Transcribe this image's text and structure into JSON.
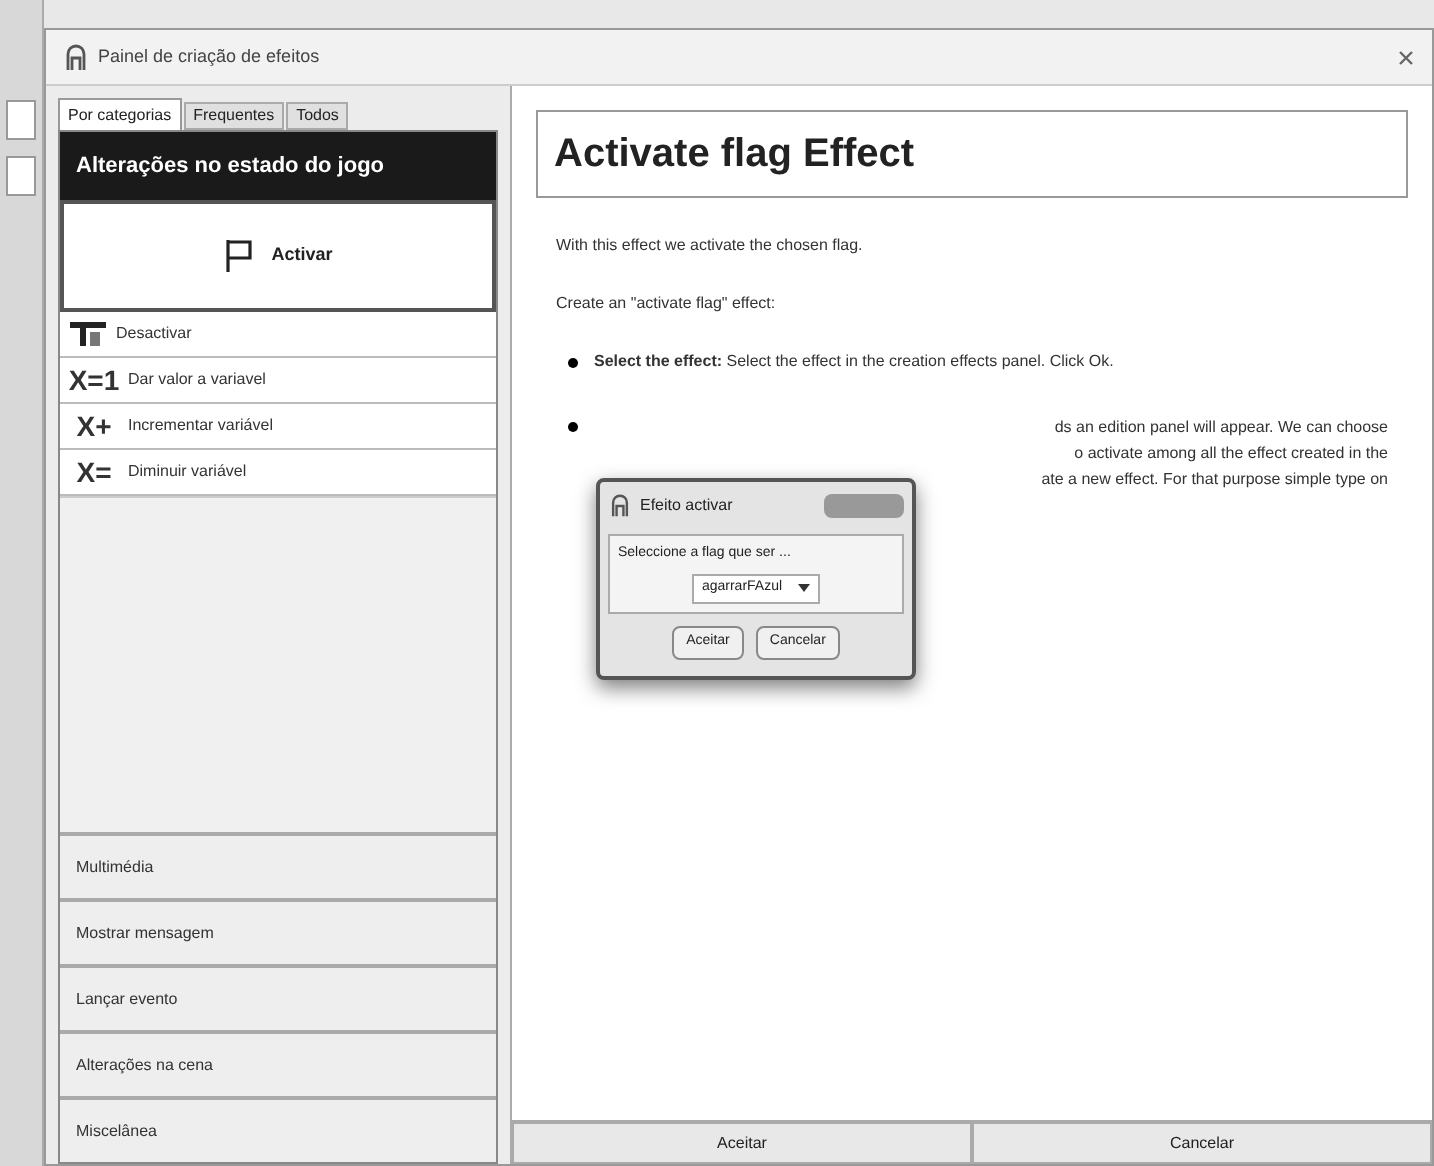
{
  "window": {
    "title": "Painel de criação de efeitos"
  },
  "tabs": [
    {
      "label": "Por categorias",
      "selected": true
    },
    {
      "label": "Frequentes",
      "selected": false
    },
    {
      "label": "Todos",
      "selected": false
    }
  ],
  "category_header": "Alterações no estado do jogo",
  "effects": [
    {
      "label": "Activar",
      "kind": "flag",
      "selected": true
    },
    {
      "label": "Desactivar",
      "kind": "unflag",
      "selected": false
    },
    {
      "label": "Dar valor a variavel",
      "kind": "text",
      "icon_text": "X=1",
      "selected": false
    },
    {
      "label": "Incrementar variável",
      "kind": "text",
      "icon_text": "X+",
      "selected": false
    },
    {
      "label": "Diminuir variável",
      "kind": "text",
      "icon_text": "X=",
      "selected": false
    }
  ],
  "categories": [
    "Multimédia",
    "Mostrar mensagem",
    "Lançar evento",
    "Alterações na cena",
    "Miscelânea"
  ],
  "help": {
    "title": "Activate flag Effect",
    "paragraphs": [
      "With this effect we activate the chosen flag.",
      "Create an \"activate flag\" effect:"
    ],
    "bullet_1": "**Select the effect:** Select the effect in the creation effects panel. Click Ok.",
    "bullet_2_visible_lines": [
      "ds an edition panel will appear. We can choose",
      "o activate among all the effect created in the",
      "ate a new effect. For that purpose simple type on"
    ]
  },
  "dialog": {
    "title": "Efeito activar",
    "group_label": "Seleccione a flag que ser ...",
    "value": "agarrarFAzul",
    "buttons": [
      "Aceitar",
      "Cancelar"
    ]
  },
  "buttons": [
    "Aceitar",
    "Cancelar"
  ]
}
